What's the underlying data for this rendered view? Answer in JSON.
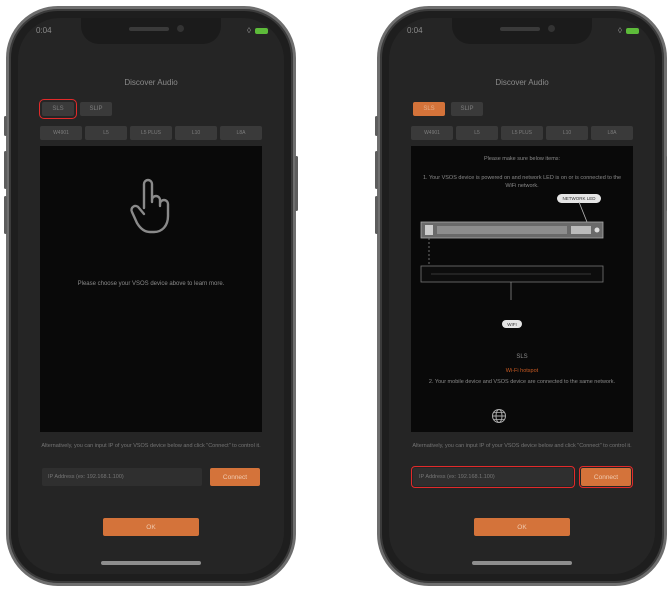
{
  "screens": [
    {
      "status_time": "0:04",
      "title": "Discover Audio",
      "protocols": [
        "SLS",
        "SLIP"
      ],
      "models": [
        "W4901",
        "L5",
        "L5 PLUS",
        "L10",
        "L8A"
      ],
      "panel_message": "Please choose your VSOS device above to learn more.",
      "manual_hint": "Alternatively, you can input IP of your VSOS device below and click \"Connect\" to control it.",
      "ip_placeholder": "IP Address (ex: 192.168.1.100)",
      "connect_label": "Connect",
      "ok_label": "OK"
    },
    {
      "status_time": "0:04",
      "title": "Discover Audio",
      "protocols": [
        "SLS",
        "SLIP"
      ],
      "models": [
        "W4901",
        "L5",
        "L5 PLUS",
        "L10",
        "L8A"
      ],
      "instructions_title": "Please make sure below items:",
      "step1": "1. Your VSOS device is powered on and network LED is on or is connected to the WiFi network.",
      "device_tag": "NETWORK LED",
      "device_bottom_tag": "WIFI",
      "device_label": "SLS",
      "hotspot_label": "Wi-Fi hotspot",
      "step2": "2. Your mobile device and VSOS device are connected to the same network.",
      "manual_hint": "Alternatively, you can input IP of your VSOS device below and click \"Connect\" to control it.",
      "ip_placeholder": "IP Address (ex: 192.168.1.100)",
      "connect_label": "Connect",
      "ok_label": "OK"
    }
  ],
  "colors": {
    "accent": "#d4733a",
    "highlight": "#e22a2a",
    "panel": "#090909",
    "screen_bg": "#252525"
  },
  "icons": {
    "pointer": "hand-pointer-icon",
    "globe": "globe-icon",
    "wifi": "wifi-icon",
    "battery": "battery-icon"
  }
}
